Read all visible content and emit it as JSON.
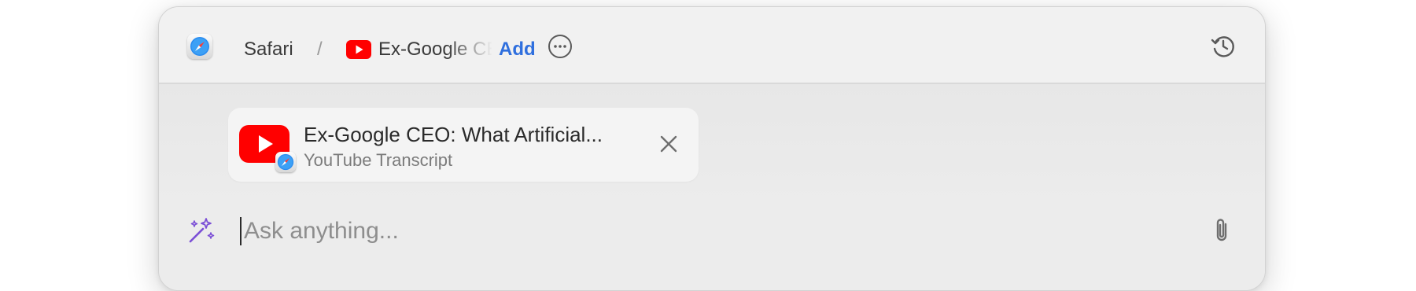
{
  "breadcrumb": {
    "app_name": "Safari",
    "separator": "/",
    "page_title": "Ex-Google CEO: What Artificial...",
    "add_label": "Add"
  },
  "icons": {
    "app": "safari-compass-icon",
    "page": "youtube-icon",
    "more": "more-ellipsis-icon",
    "history": "history-clock-icon",
    "close": "close-icon",
    "wand": "magic-wand-icon",
    "attach": "paperclip-icon"
  },
  "context_chip": {
    "title": "Ex-Google CEO: What Artificial...",
    "subtitle": "YouTube Transcript"
  },
  "prompt": {
    "placeholder": "Ask anything..."
  },
  "colors": {
    "accent": "#2f6fde",
    "youtube_red": "#ff0000",
    "wand_purple": "#7b4fd6"
  }
}
